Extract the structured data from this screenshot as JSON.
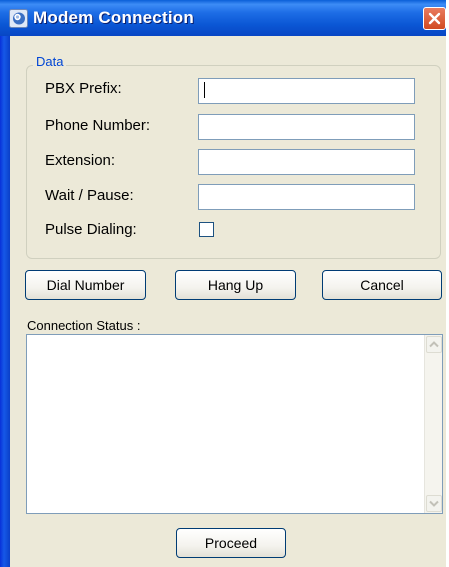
{
  "window": {
    "title": "Modem Connection",
    "title_icon": "modem-app-icon",
    "close_icon": "close-icon",
    "colors": {
      "titlebar": "#0a56d4",
      "close": "#d14a21",
      "face": "#ece9d8",
      "group_label": "#0046d5"
    }
  },
  "data_group": {
    "label": "Data",
    "fields": [
      {
        "label": "PBX Prefix:",
        "value": ""
      },
      {
        "label": "Phone Number:",
        "value": ""
      },
      {
        "label": "Extension:",
        "value": ""
      },
      {
        "label": "Wait / Pause:",
        "value": ""
      }
    ],
    "pulse_dialing": {
      "label": "Pulse Dialing:",
      "checked": false
    }
  },
  "buttons": {
    "dial": "Dial Number",
    "hangup": "Hang Up",
    "cancel": "Cancel",
    "proceed": "Proceed"
  },
  "status": {
    "label": "Connection Status :",
    "text": "",
    "scroll_up_icon": "scroll-up-arrow-icon",
    "scroll_down_icon": "scroll-down-arrow-icon"
  }
}
